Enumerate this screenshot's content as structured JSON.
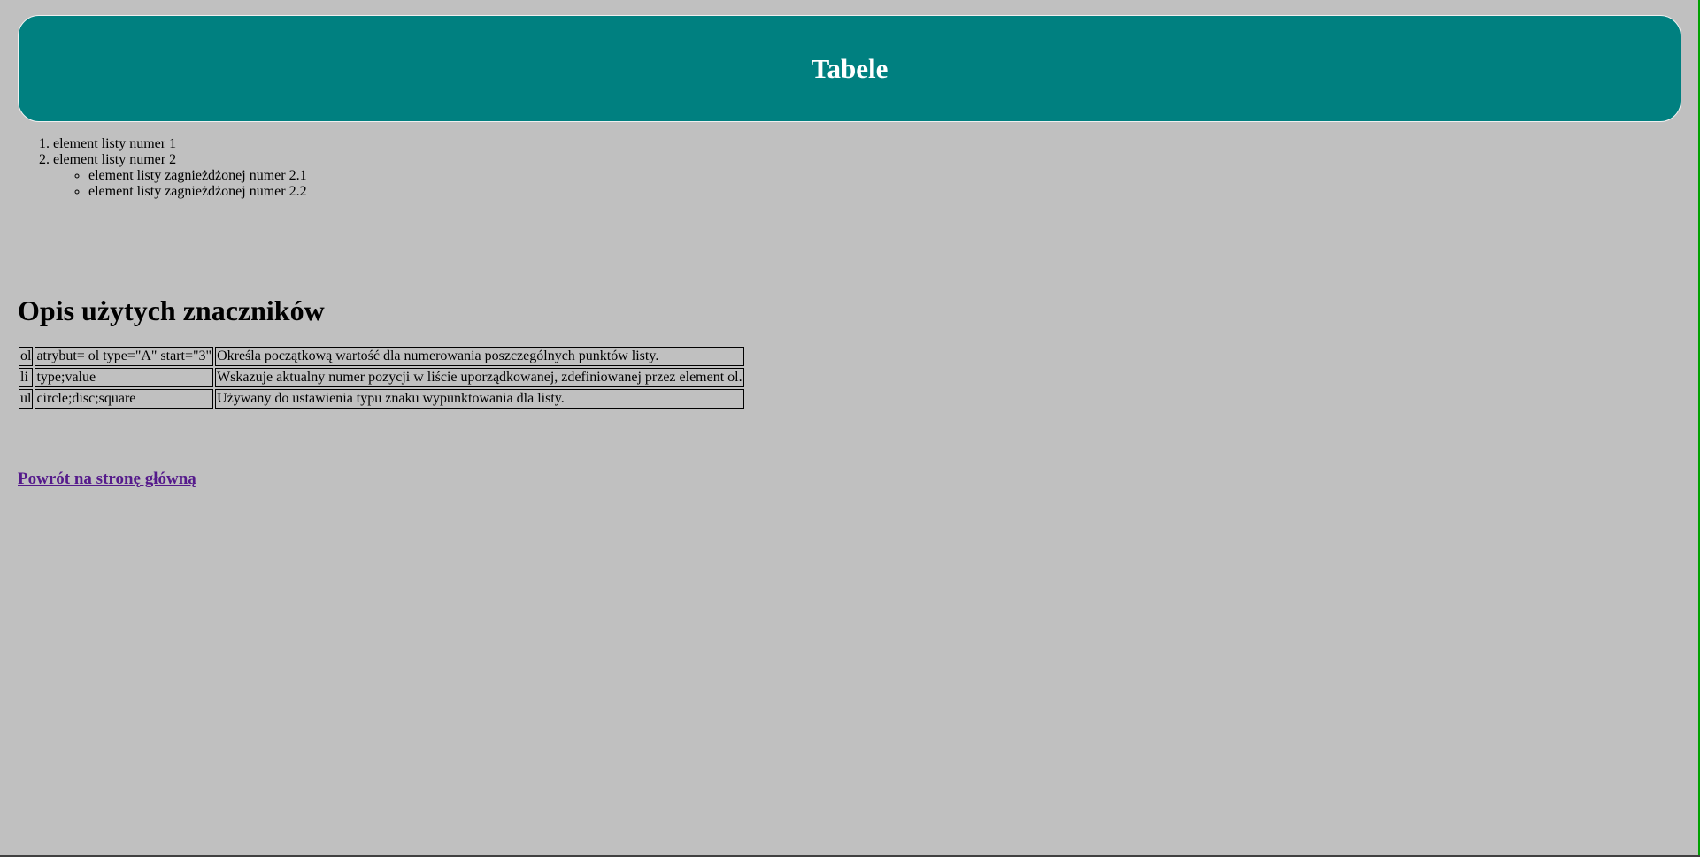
{
  "header": {
    "title": "Tabele"
  },
  "list": {
    "items": [
      {
        "label": "element listy numer 1"
      },
      {
        "label": "element listy numer 2",
        "children": [
          {
            "label": "element listy zagnieżdżonej numer 2.1"
          },
          {
            "label": "element listy zagnieżdżonej numer 2.2"
          }
        ]
      }
    ]
  },
  "section": {
    "title": "Opis użytych znaczników"
  },
  "table": {
    "rows": [
      {
        "tag": "ol",
        "attrs": "atrybut= ol type=\"A\" start=\"3\"",
        "desc": "Określa początkową wartość dla numerowania poszczególnych punktów listy."
      },
      {
        "tag": "li",
        "attrs": "type;value",
        "desc": "Wskazuje aktualny numer pozycji w liście uporządkowanej, zdefiniowanej przez element ol."
      },
      {
        "tag": "ul",
        "attrs": "circle;disc;square",
        "desc": "Używany do ustawienia typu znaku wypunktowania dla listy."
      }
    ]
  },
  "footer": {
    "back_link": "Powrót na stronę główną"
  },
  "colors": {
    "background": "#c0c0c0",
    "header_bg": "#008080",
    "header_text": "#ffffff",
    "link": "#551a8b"
  }
}
